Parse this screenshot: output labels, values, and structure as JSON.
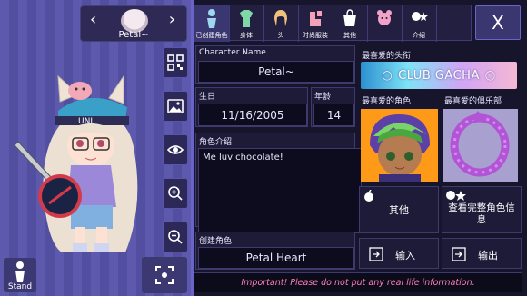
{
  "character_selector": {
    "name": "Petal~",
    "prev_icon": "chevron-left-icon",
    "next_icon": "chevron-right-icon"
  },
  "tools": [
    {
      "icon": "qr-code-icon"
    },
    {
      "icon": "image-icon"
    },
    {
      "icon": "eye-icon"
    },
    {
      "icon": "zoom-in-icon"
    },
    {
      "icon": "zoom-out-icon"
    }
  ],
  "stand_button": {
    "label": "Stand"
  },
  "capture_button": {
    "icon": "capture-focus-icon"
  },
  "tabs": [
    {
      "label": "已创建角色",
      "icon": "person-icon",
      "active": true
    },
    {
      "label": "身体",
      "icon": "shirt-icon",
      "active": false
    },
    {
      "label": "头",
      "icon": "hair-icon",
      "active": false
    },
    {
      "label": "时尚服装",
      "icon": "fashion-icon",
      "active": false
    },
    {
      "label": "其他",
      "icon": "shopping-bag-icon",
      "active": false
    },
    {
      "label": "",
      "icon": "pet-face-icon",
      "active": false
    },
    {
      "label": "介绍",
      "icon": "face-star-icon",
      "active": false
    }
  ],
  "close_button": {
    "label": "X"
  },
  "form": {
    "name_label": "Character Name",
    "name_value": "Petal~",
    "birthday_label": "生日",
    "birthday_value": "11/16/2005",
    "age_label": "年龄",
    "age_value": "14",
    "intro_label": "角色介绍",
    "intro_value": "Me luv chocolate!",
    "creator_label": "创建角色",
    "creator_value": "Petal Heart"
  },
  "favorites": {
    "headwear_label": "最喜爱的头衔",
    "headwear_value": "CLUB GACHA",
    "char_label": "最喜爱的角色",
    "pet_label": "最喜爱的俱乐部"
  },
  "actions": {
    "other": "其他",
    "view_full": "查看完整角色信息",
    "import": "输入",
    "export": "输出"
  },
  "notice": "Important! Please do not put any real life information.",
  "colors": {
    "accent": "#6a64c8",
    "gacha_gradient_start": "#2c8fd0",
    "notice_text": "#ff7fb5",
    "char_bg": "#ff9a18"
  }
}
